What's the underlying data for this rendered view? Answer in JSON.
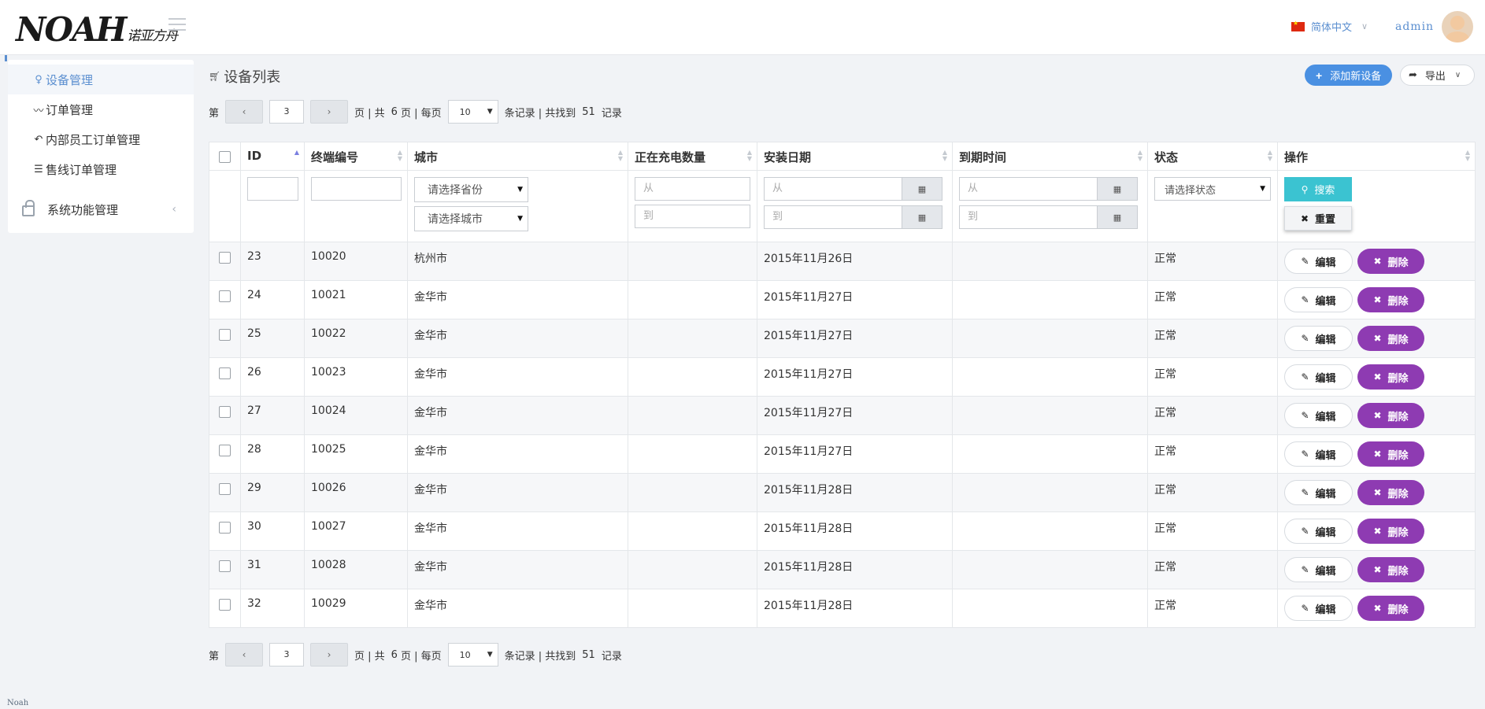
{
  "header": {
    "logo_text": "NOAH",
    "logo_sub": "诺亚方舟",
    "language": "简体中文",
    "username": "admin",
    "colors": {
      "accent": "#5b8fd0",
      "flag": "#de2910"
    }
  },
  "sidebar": {
    "items": [
      {
        "label": "设备管理",
        "icon": "bulb-icon",
        "active": true
      },
      {
        "label": "订单管理",
        "icon": "trend-icon"
      },
      {
        "label": "内部员工订单管理",
        "icon": "reply-icon"
      },
      {
        "label": "售线订单管理",
        "icon": "list-icon"
      }
    ],
    "group": {
      "label": "系统功能管理",
      "icon": "lock-icon"
    }
  },
  "main": {
    "title": "设备列表",
    "add_button": "添加新设备",
    "export_button": "导出",
    "colors": {
      "add": "#4a90e2",
      "search": "#3bc3d1",
      "delete": "#8e3bb2"
    }
  },
  "pager": {
    "prefix": "第",
    "prev": "‹",
    "next": "›",
    "page": "3",
    "pages_text": "页 | 共",
    "total_pages": "6",
    "per_page_text": "页 | 每页",
    "page_size": "10",
    "records_text": "条记录 | 共找到",
    "total": "51",
    "records_suffix": "记录"
  },
  "table": {
    "columns": [
      "ID",
      "终端编号",
      "城市",
      "正在充电数量",
      "安装日期",
      "到期时间",
      "状态",
      "操作"
    ],
    "filters": {
      "province_placeholder": "请选择省份",
      "city_placeholder": "请选择城市",
      "from": "从",
      "to": "到",
      "status_placeholder": "请选择状态",
      "search": "搜索",
      "reset": "重置"
    },
    "edit_label": "编辑",
    "delete_label": "删除",
    "rows": [
      {
        "id": "23",
        "terminal": "10020",
        "city": "杭州市",
        "charging": "",
        "install_date": "2015年11月26日",
        "expire": "",
        "status": "正常"
      },
      {
        "id": "24",
        "terminal": "10021",
        "city": "金华市",
        "charging": "",
        "install_date": "2015年11月27日",
        "expire": "",
        "status": "正常"
      },
      {
        "id": "25",
        "terminal": "10022",
        "city": "金华市",
        "charging": "",
        "install_date": "2015年11月27日",
        "expire": "",
        "status": "正常"
      },
      {
        "id": "26",
        "terminal": "10023",
        "city": "金华市",
        "charging": "",
        "install_date": "2015年11月27日",
        "expire": "",
        "status": "正常"
      },
      {
        "id": "27",
        "terminal": "10024",
        "city": "金华市",
        "charging": "",
        "install_date": "2015年11月27日",
        "expire": "",
        "status": "正常"
      },
      {
        "id": "28",
        "terminal": "10025",
        "city": "金华市",
        "charging": "",
        "install_date": "2015年11月27日",
        "expire": "",
        "status": "正常"
      },
      {
        "id": "29",
        "terminal": "10026",
        "city": "金华市",
        "charging": "",
        "install_date": "2015年11月28日",
        "expire": "",
        "status": "正常"
      },
      {
        "id": "30",
        "terminal": "10027",
        "city": "金华市",
        "charging": "",
        "install_date": "2015年11月28日",
        "expire": "",
        "status": "正常"
      },
      {
        "id": "31",
        "terminal": "10028",
        "city": "金华市",
        "charging": "",
        "install_date": "2015年11月28日",
        "expire": "",
        "status": "正常"
      },
      {
        "id": "32",
        "terminal": "10029",
        "city": "金华市",
        "charging": "",
        "install_date": "2015年11月28日",
        "expire": "",
        "status": "正常"
      }
    ]
  },
  "footer": {
    "text": "Noah"
  }
}
